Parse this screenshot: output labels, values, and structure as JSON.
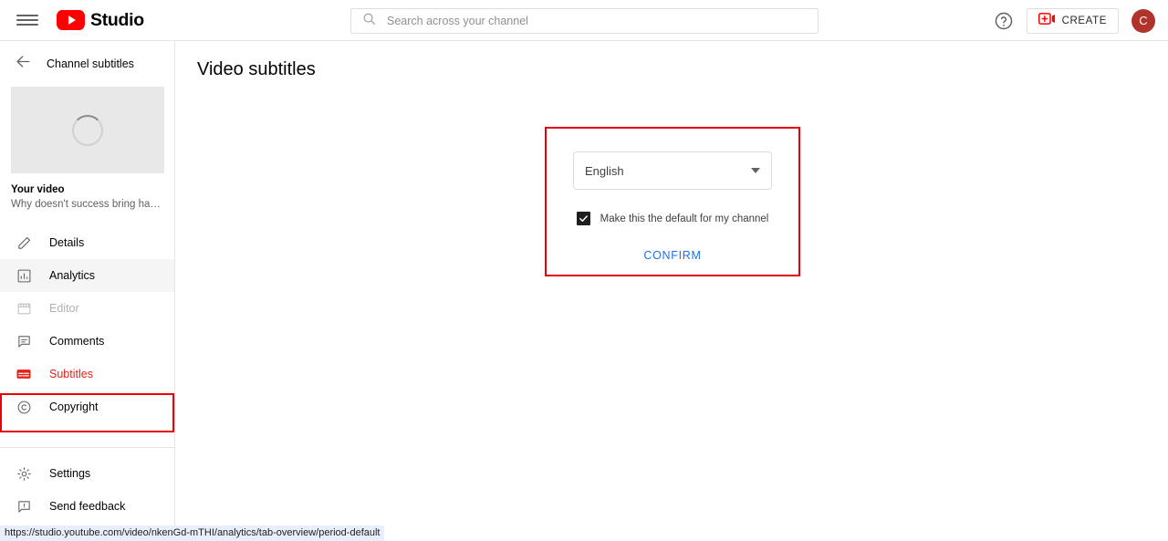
{
  "header": {
    "menu_icon": "hamburger-icon",
    "brand": "Studio",
    "search": {
      "placeholder": "Search across your channel",
      "value": "",
      "icon": "search-icon"
    },
    "help_icon": "help-circle-icon",
    "create_label": "CREATE",
    "create_icon": "video-plus-icon",
    "avatar_letter": "C",
    "avatar_color": "#b0342c"
  },
  "sidebar": {
    "back_label": "Channel subtitles",
    "back_icon": "arrow-left-icon",
    "thumbnail_state": "loading-spinner",
    "video_title": "Your video",
    "video_subtitle": "Why doesn't success bring happines…",
    "items": [
      {
        "label": "Details",
        "icon": "pencil-icon",
        "state": "default"
      },
      {
        "label": "Analytics",
        "icon": "bar-chart-icon",
        "state": "hover"
      },
      {
        "label": "Editor",
        "icon": "film-icon",
        "state": "disabled"
      },
      {
        "label": "Comments",
        "icon": "comment-icon",
        "state": "default"
      },
      {
        "label": "Subtitles",
        "icon": "subtitles-icon",
        "state": "active"
      },
      {
        "label": "Copyright",
        "icon": "copyright-icon",
        "state": "default"
      }
    ],
    "bottom_items": [
      {
        "label": "Settings",
        "icon": "gear-icon"
      },
      {
        "label": "Send feedback",
        "icon": "feedback-icon"
      }
    ],
    "active_color": "#e62117",
    "highlight_color": "#e8000d"
  },
  "main": {
    "page_title": "Video subtitles",
    "panel": {
      "language_value": "English",
      "language_caret_icon": "chevron-down-icon",
      "checkbox_checked": true,
      "checkbox_label": "Make this the default for my channel",
      "confirm_label": "CONFIRM",
      "confirm_color": "#1a73e8",
      "border_color": "#e8000d"
    }
  },
  "statusbar": {
    "url": "https://studio.youtube.com/video/nkenGd-mTHI/analytics/tab-overview/period-default"
  }
}
